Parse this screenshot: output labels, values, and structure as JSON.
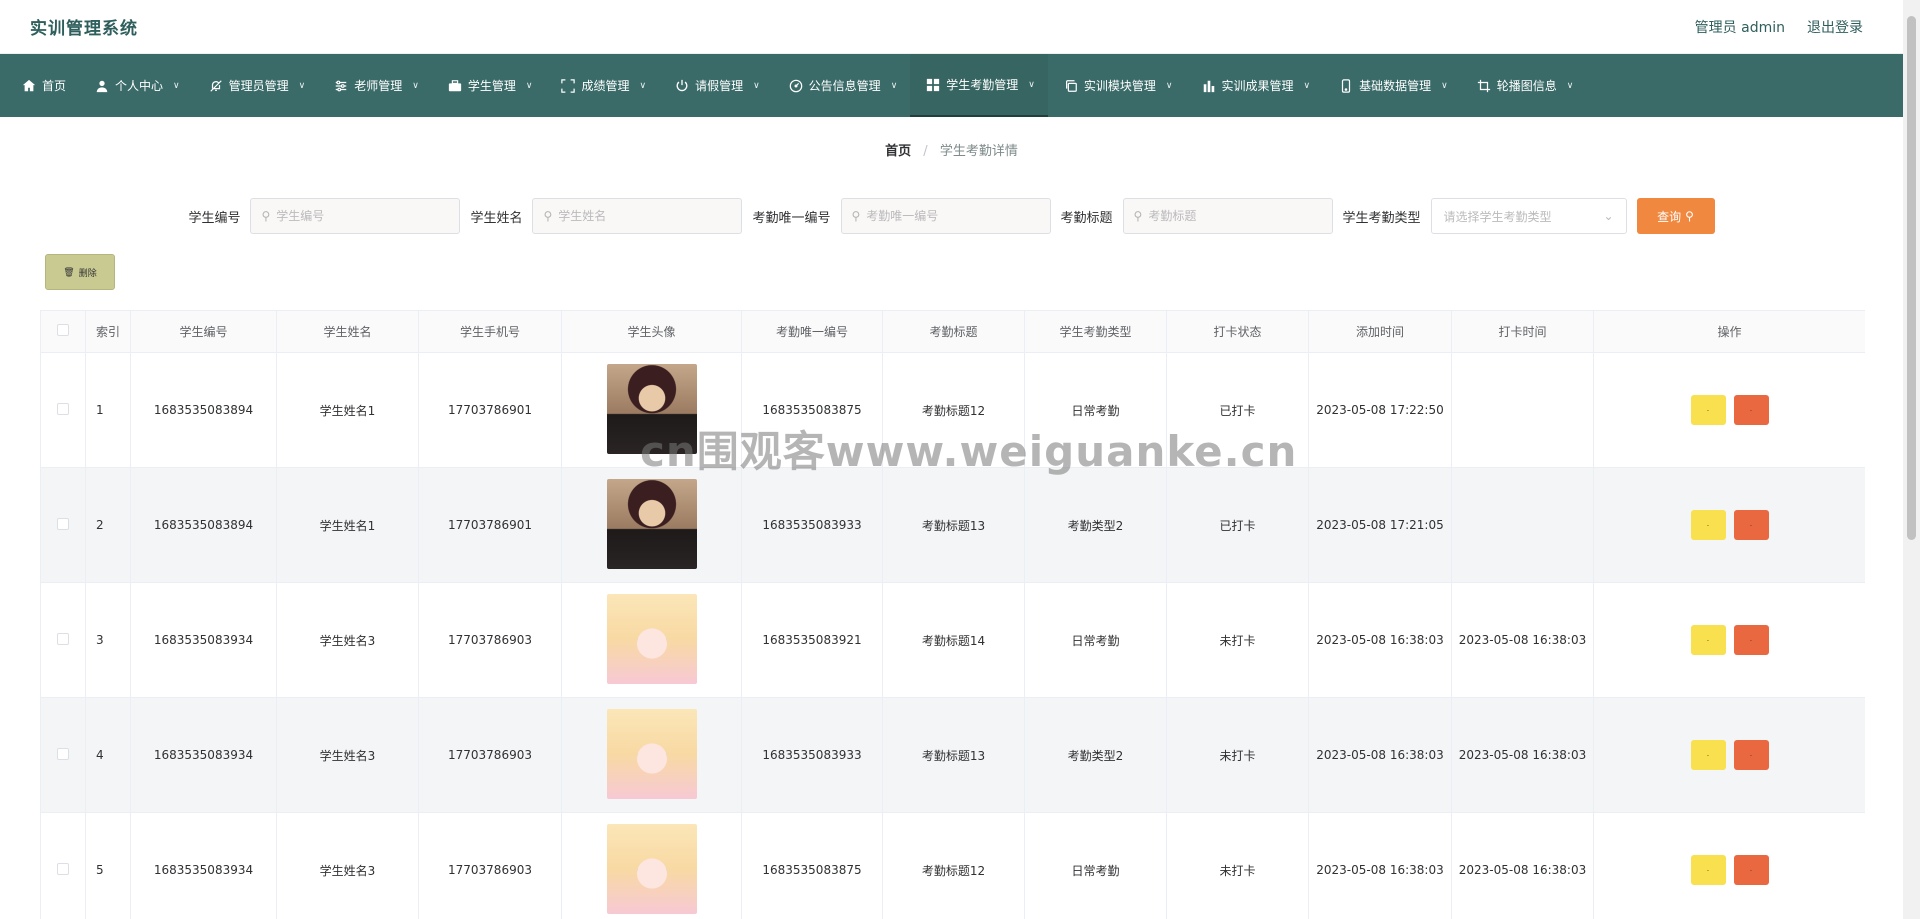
{
  "header": {
    "app_title": "实训管理系统",
    "user_label": "管理员 admin",
    "logout_label": "退出登录"
  },
  "nav": [
    {
      "label": "首页",
      "icon": "home-icon"
    },
    {
      "label": "个人中心",
      "icon": "user-icon"
    },
    {
      "label": "管理员管理",
      "icon": "bell-off-icon"
    },
    {
      "label": "老师管理",
      "icon": "sliders-icon"
    },
    {
      "label": "学生管理",
      "icon": "briefcase-icon"
    },
    {
      "label": "成绩管理",
      "icon": "fullscreen-icon"
    },
    {
      "label": "请假管理",
      "icon": "power-icon"
    },
    {
      "label": "公告信息管理",
      "icon": "dial-icon"
    },
    {
      "label": "学生考勤管理",
      "icon": "grid-icon"
    },
    {
      "label": "实训模块管理",
      "icon": "copy-icon"
    },
    {
      "label": "实训成果管理",
      "icon": "chart-icon"
    },
    {
      "label": "基础数据管理",
      "icon": "phone-icon"
    },
    {
      "label": "轮播图信息",
      "icon": "crop-icon"
    }
  ],
  "breadcrumb": {
    "home": "首页",
    "separator": "/",
    "current": "学生考勤详情"
  },
  "search": {
    "student_no_label": "学生编号",
    "student_no_placeholder": "学生编号",
    "student_name_label": "学生姓名",
    "student_name_placeholder": "学生姓名",
    "attendance_no_label": "考勤唯一编号",
    "attendance_no_placeholder": "考勤唯一编号",
    "attendance_title_label": "考勤标题",
    "attendance_title_placeholder": "考勤标题",
    "type_label": "学生考勤类型",
    "type_placeholder": "请选择学生考勤类型",
    "query_label": "查询"
  },
  "toolbar": {
    "delete_label": "删除"
  },
  "table": {
    "columns": [
      "索引",
      "学生编号",
      "学生姓名",
      "学生手机号",
      "学生头像",
      "考勤唯一编号",
      "考勤标题",
      "学生考勤类型",
      "打卡状态",
      "添加时间",
      "打卡时间",
      "操作"
    ],
    "rows": [
      {
        "index": "1",
        "student_no": "1683535083894",
        "name": "学生姓名1",
        "phone": "17703786901",
        "avatar": "male",
        "att_no": "1683535083875",
        "title": "考勤标题12",
        "type": "日常考勤",
        "status": "已打卡",
        "added": "2023-05-08 17:22:50",
        "punched": ""
      },
      {
        "index": "2",
        "student_no": "1683535083894",
        "name": "学生姓名1",
        "phone": "17703786901",
        "avatar": "male",
        "att_no": "1683535083933",
        "title": "考勤标题13",
        "type": "考勤类型2",
        "status": "已打卡",
        "added": "2023-05-08 17:21:05",
        "punched": ""
      },
      {
        "index": "3",
        "student_no": "1683535083934",
        "name": "学生姓名3",
        "phone": "17703786903",
        "avatar": "female",
        "att_no": "1683535083921",
        "title": "考勤标题14",
        "type": "日常考勤",
        "status": "未打卡",
        "added": "2023-05-08 16:38:03",
        "punched": "2023-05-08 16:38:03"
      },
      {
        "index": "4",
        "student_no": "1683535083934",
        "name": "学生姓名3",
        "phone": "17703786903",
        "avatar": "female",
        "att_no": "1683535083933",
        "title": "考勤标题13",
        "type": "考勤类型2",
        "status": "未打卡",
        "added": "2023-05-08 16:38:03",
        "punched": "2023-05-08 16:38:03"
      },
      {
        "index": "5",
        "student_no": "1683535083934",
        "name": "学生姓名3",
        "phone": "17703786903",
        "avatar": "female",
        "att_no": "1683535083875",
        "title": "考勤标题12",
        "type": "日常考勤",
        "status": "未打卡",
        "added": "2023-05-08 16:38:03",
        "punched": "2023-05-08 16:38:03"
      }
    ],
    "edit_label": "·",
    "delete_label": "·"
  },
  "watermark": "cn围观客www.weiguanke.cn",
  "colors": {
    "nav_bg": "#3a6b68",
    "brand_text": "#2f5f5c",
    "query_button": "#f0883f",
    "delete_button": "#c9ca92",
    "edit_op": "#f8e04f",
    "delete_op": "#ea6840"
  }
}
